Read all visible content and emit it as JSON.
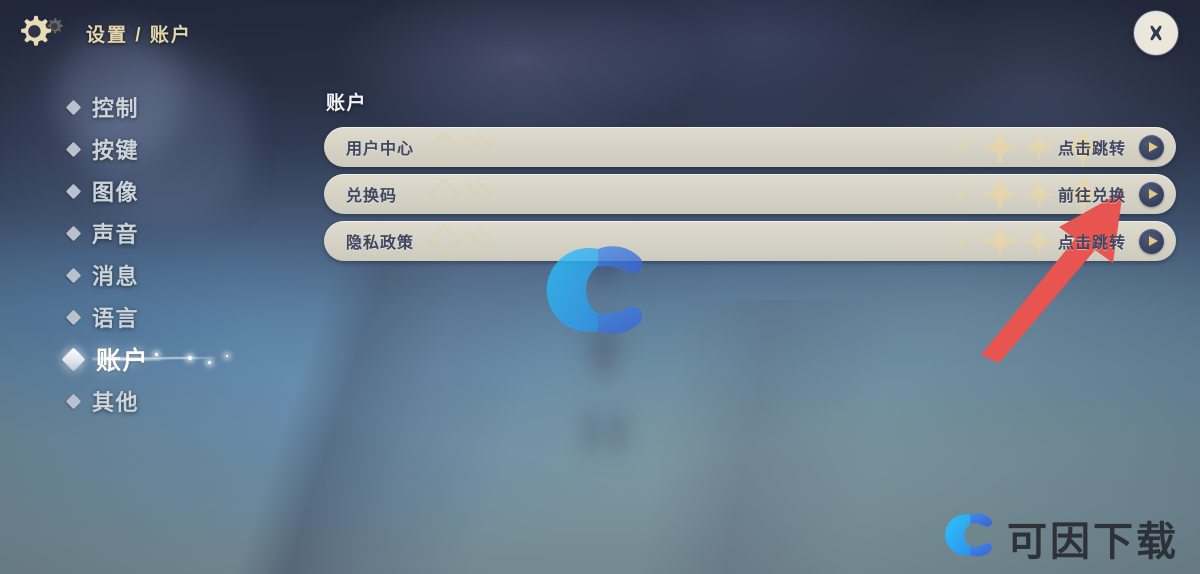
{
  "header": {
    "gear_icon": "gear-icon",
    "breadcrumb": "设置 / 账户",
    "close_icon": "close-icon",
    "close_label": "关闭"
  },
  "sidebar": {
    "items": [
      {
        "label": "控制",
        "name": "sidebar-item-control",
        "active": false
      },
      {
        "label": "按键",
        "name": "sidebar-item-keys",
        "active": false
      },
      {
        "label": "图像",
        "name": "sidebar-item-graphics",
        "active": false
      },
      {
        "label": "声音",
        "name": "sidebar-item-audio",
        "active": false
      },
      {
        "label": "消息",
        "name": "sidebar-item-messages",
        "active": false
      },
      {
        "label": "语言",
        "name": "sidebar-item-language",
        "active": false
      },
      {
        "label": "账户",
        "name": "sidebar-item-account",
        "active": true
      },
      {
        "label": "其他",
        "name": "sidebar-item-other",
        "active": false
      }
    ]
  },
  "panel": {
    "title": "账户",
    "rows": [
      {
        "label": "用户中心",
        "action": "点击跳转",
        "arrow_icon": "chevron-right-icon"
      },
      {
        "label": "兑换码",
        "action": "前往兑换",
        "arrow_icon": "chevron-right-icon"
      },
      {
        "label": "隐私政策",
        "action": "点击跳转",
        "arrow_icon": "chevron-right-icon"
      }
    ]
  },
  "watermark": {
    "center_logo": "letter-c-logo",
    "corner_logo": "letter-c-logo",
    "corner_text": "可因下载"
  },
  "annotation": {
    "arrow": "red-arrow-annotation",
    "points_at": "前往兑换"
  },
  "colors": {
    "accent_gold": "#e3d6ae",
    "row_fill": "#d6d2c6",
    "row_text": "#3d4760",
    "circle_navy": "#394563",
    "arrow_gold": "#e5c87f",
    "annotation_red": "#e8544f",
    "logo_cyan": "#29b6f6",
    "logo_blue": "#3d72d8",
    "active_nav": "#fdfcf6"
  }
}
